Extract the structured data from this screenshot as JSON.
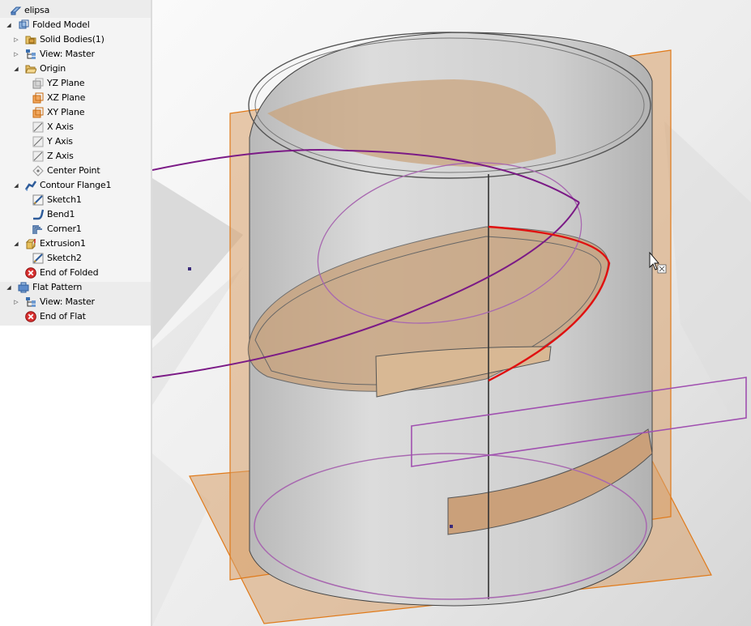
{
  "browser": {
    "root": "elipsa",
    "folded_model": "Folded Model",
    "solid_bodies": "Solid Bodies(1)",
    "view_master": "View: Master",
    "origin": "Origin",
    "yz_plane": "YZ Plane",
    "xz_plane": "XZ Plane",
    "xy_plane": "XY Plane",
    "x_axis": "X Axis",
    "y_axis": "Y Axis",
    "z_axis": "Z Axis",
    "center_point": "Center Point",
    "contour_flange": "Contour Flange1",
    "sketch1": "Sketch1",
    "bend1": "Bend1",
    "corner1": "Corner1",
    "extrusion1": "Extrusion1",
    "sketch2": "Sketch2",
    "end_of_folded": "End of Folded",
    "flat_pattern": "Flat Pattern",
    "view_master_flat": "View: Master",
    "end_of_flat": "End of Flat"
  },
  "colors": {
    "plane_fill": "#d9a06a",
    "plane_edge": "#e07a1a",
    "sheet_metal": "#c9c9c9",
    "sketch_curve": "#7b1a86",
    "selected_edge": "#e01010",
    "end_marker": "#d83030"
  },
  "icons": {
    "root": "part-icon",
    "folded_model": "folded-model-icon",
    "solid_bodies": "solid-bodies-icon",
    "view": "view-rep-icon",
    "origin": "folder-icon",
    "plane": "work-plane-icon",
    "axis": "work-axis-icon",
    "center_point": "work-point-icon",
    "flange": "contour-flange-icon",
    "sketch": "sketch-icon",
    "bend": "bend-icon",
    "corner": "corner-icon",
    "extrusion": "extrusion-icon",
    "end_marker": "end-of-part-icon",
    "flat_pattern": "flat-pattern-icon",
    "cursor": "move-cursor-icon"
  }
}
